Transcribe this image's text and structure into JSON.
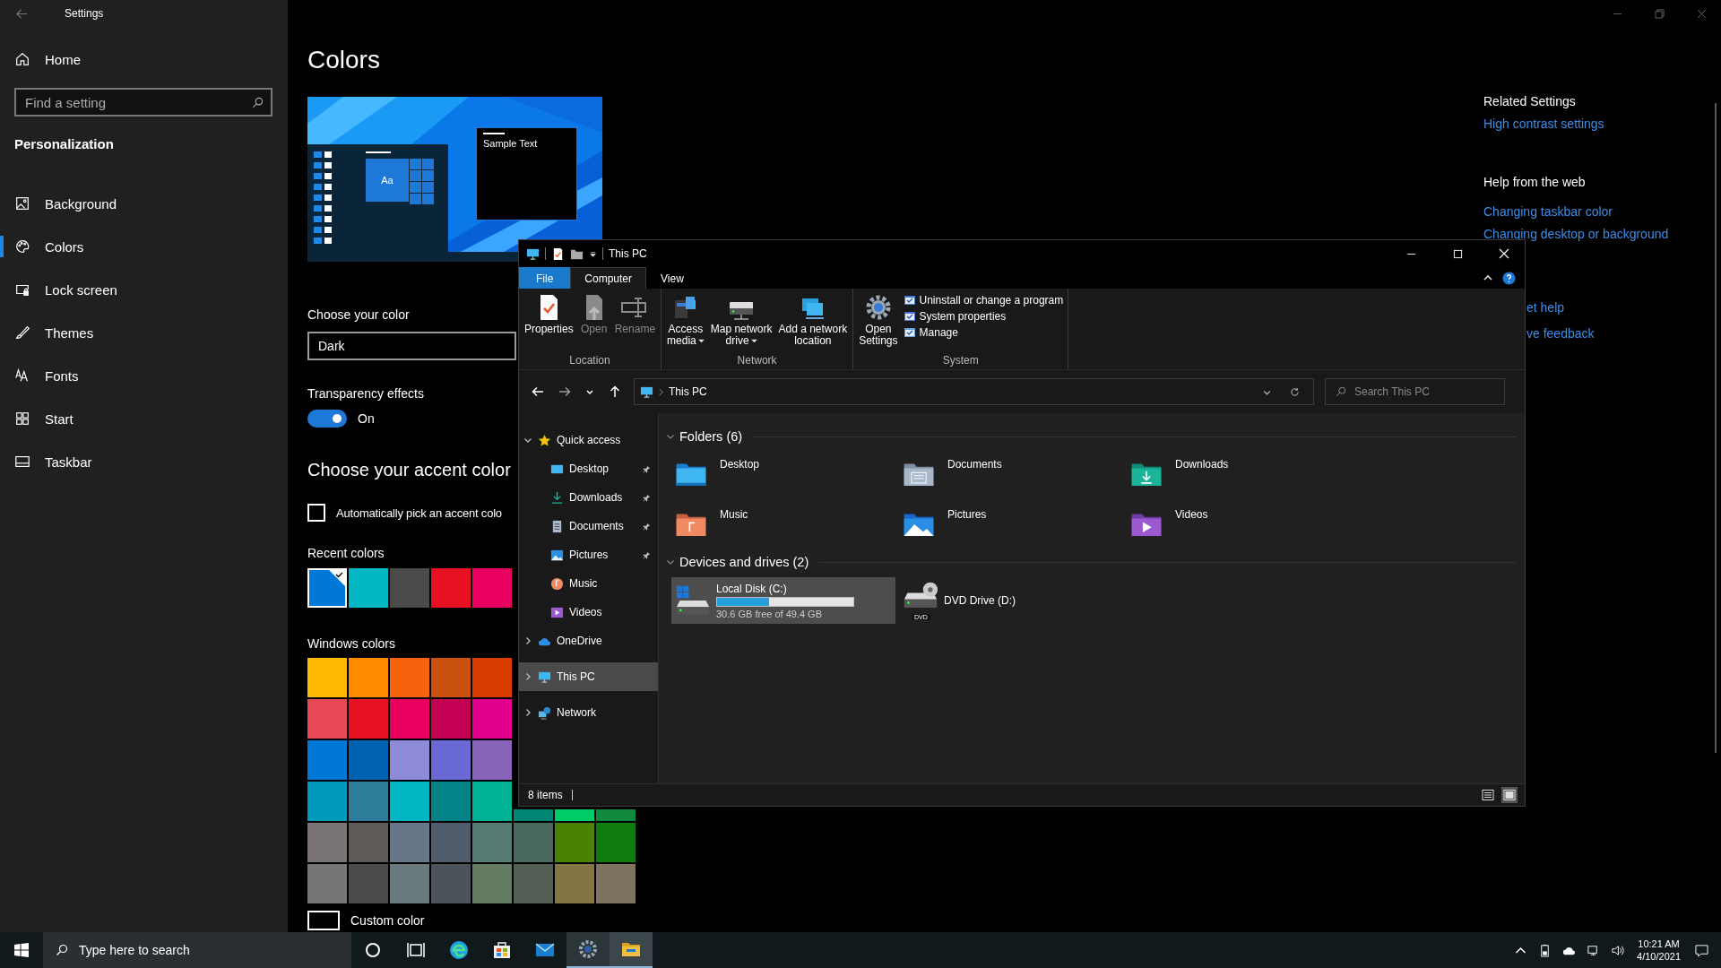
{
  "settings": {
    "title": "Settings",
    "home": "Home",
    "search": {
      "placeholder": "Find a setting"
    },
    "section": "Personalization",
    "nav": [
      {
        "label": "Background",
        "kind": "background",
        "selected": false
      },
      {
        "label": "Colors",
        "kind": "colors",
        "selected": true
      },
      {
        "label": "Lock screen",
        "kind": "lock",
        "selected": false
      },
      {
        "label": "Themes",
        "kind": "themes",
        "selected": false
      },
      {
        "label": "Fonts",
        "kind": "fonts",
        "selected": false
      },
      {
        "label": "Start",
        "kind": "start",
        "selected": false
      },
      {
        "label": "Taskbar",
        "kind": "taskbar",
        "selected": false
      }
    ],
    "page_title": "Colors",
    "preview": {
      "sample_text": "Sample Text",
      "tile_text": "Aa"
    },
    "color_mode": {
      "label": "Choose your color",
      "value": "Dark"
    },
    "transparency": {
      "label": "Transparency effects",
      "on": true,
      "state_text": "On"
    },
    "accent_title": "Choose your accent color",
    "auto_pick": {
      "label": "Automatically pick an accent colo",
      "checked": false
    },
    "recent": {
      "label": "Recent colors",
      "swatches": [
        {
          "color": "#0078d7",
          "selected": true
        },
        {
          "color": "#00b7c3",
          "selected": false
        },
        {
          "color": "#4c4a48",
          "selected": false
        },
        {
          "color": "#e81123",
          "selected": false
        },
        {
          "color": "#ea005e",
          "selected": false
        }
      ]
    },
    "windows_colors": {
      "label": "Windows colors",
      "rows": [
        [
          {
            "color": "#ffb900"
          },
          {
            "color": "#ff8c00"
          },
          {
            "color": "#f7630c"
          },
          {
            "color": "#ca5010"
          },
          {
            "color": "#da3b01"
          }
        ],
        [
          {
            "color": "#e74856"
          },
          {
            "color": "#e81123"
          },
          {
            "color": "#ea005e"
          },
          {
            "color": "#c30052"
          },
          {
            "color": "#e3008c"
          }
        ],
        [
          {
            "color": "#0078d7"
          },
          {
            "color": "#0063b1"
          },
          {
            "color": "#8e8cd8"
          },
          {
            "color": "#6b69d6"
          },
          {
            "color": "#8764b8"
          }
        ],
        [
          {
            "color": "#0099bc"
          },
          {
            "color": "#2d7d9a"
          },
          {
            "color": "#00b7c3"
          },
          {
            "color": "#038387"
          },
          {
            "color": "#00b294"
          },
          {
            "color": "#018574"
          },
          {
            "color": "#00cc6a"
          },
          {
            "color": "#10893e"
          }
        ],
        [
          {
            "color": "#7a7574"
          },
          {
            "color": "#5d5a58"
          },
          {
            "color": "#68768a"
          },
          {
            "color": "#515c6b"
          },
          {
            "color": "#567c73"
          },
          {
            "color": "#486860"
          },
          {
            "color": "#498205"
          },
          {
            "color": "#107c10"
          }
        ],
        [
          {
            "color": "#767676"
          },
          {
            "color": "#4c4a48"
          },
          {
            "color": "#69797e"
          },
          {
            "color": "#4a5459"
          },
          {
            "color": "#647c64"
          },
          {
            "color": "#525e54"
          },
          {
            "color": "#847545"
          },
          {
            "color": "#7e735f"
          }
        ]
      ]
    },
    "custom_color": "Custom color",
    "related": {
      "title": "Related Settings",
      "links": [
        "High contrast settings"
      ]
    },
    "help": {
      "title": "Help from the web",
      "links": [
        "Changing taskbar color",
        "Changing desktop or background"
      ]
    },
    "support_links": [
      "et help",
      "ve feedback"
    ]
  },
  "explorer": {
    "title": "This PC",
    "tabs": [
      {
        "label": "File",
        "kind": "file",
        "selected": false
      },
      {
        "label": "Computer",
        "kind": "tab",
        "selected": true
      },
      {
        "label": "View",
        "kind": "tab",
        "selected": false
      }
    ],
    "ribbon": [
      {
        "group": "Location",
        "commands": [
          {
            "label": "Properties",
            "disabled": false,
            "dropdown": false
          },
          {
            "label": "Open",
            "disabled": true,
            "dropdown": false
          },
          {
            "label": "Rename",
            "disabled": true,
            "dropdown": false
          }
        ]
      },
      {
        "group": "Network",
        "commands": [
          {
            "label": "Access\nmedia",
            "disabled": false,
            "dropdown": true
          },
          {
            "label": "Map network\ndrive",
            "disabled": false,
            "dropdown": true
          },
          {
            "label": "Add a network\nlocation",
            "disabled": false,
            "dropdown": false
          }
        ]
      },
      {
        "group": "System",
        "commands": [
          {
            "label": "Open\nSettings",
            "disabled": false,
            "dropdown": false
          }
        ],
        "small_commands": [
          {
            "label": "Uninstall or change a program"
          },
          {
            "label": "System properties"
          },
          {
            "label": "Manage"
          }
        ]
      }
    ],
    "address": {
      "path": "This PC"
    },
    "search": {
      "placeholder": "Search This PC"
    },
    "nav": [
      {
        "label": "Quick access",
        "kind": "star",
        "expanded": true,
        "selected": false,
        "children": [
          {
            "label": "Desktop",
            "kind": "desktop",
            "pinned": true
          },
          {
            "label": "Downloads",
            "kind": "downloads",
            "pinned": true
          },
          {
            "label": "Documents",
            "kind": "documents",
            "pinned": true
          },
          {
            "label": "Pictures",
            "kind": "pictures",
            "pinned": true
          },
          {
            "label": "Music",
            "kind": "music",
            "pinned": false
          },
          {
            "label": "Videos",
            "kind": "videos",
            "pinned": false
          }
        ]
      },
      {
        "label": "OneDrive",
        "kind": "cloud",
        "expanded": false,
        "selected": false
      },
      {
        "label": "This PC",
        "kind": "pc",
        "expanded": false,
        "selected": true
      },
      {
        "label": "Network",
        "kind": "network",
        "expanded": false,
        "selected": false
      }
    ],
    "groups": [
      {
        "title": "Folders (6)",
        "kind": "folders",
        "expanded": true,
        "items": [
          {
            "label": "Desktop",
            "kind": "desktop"
          },
          {
            "label": "Documents",
            "kind": "documents"
          },
          {
            "label": "Downloads",
            "kind": "downloads"
          },
          {
            "label": "Music",
            "kind": "music"
          },
          {
            "label": "Pictures",
            "kind": "pictures"
          },
          {
            "label": "Videos",
            "kind": "videos"
          }
        ]
      },
      {
        "title": "Devices and drives (2)",
        "kind": "drives",
        "expanded": true,
        "items": [
          {
            "label": "Local Disk (C:)",
            "kind": "disk",
            "detail": "30.6 GB free of 49.4 GB",
            "level": 0.38,
            "selected": true
          },
          {
            "label": "DVD Drive (D:)",
            "kind": "dvd",
            "icon_text": "DVD",
            "selected": false
          }
        ]
      }
    ],
    "status": "8 items",
    "views": [
      {
        "kind": "details",
        "selected": false
      },
      {
        "kind": "large",
        "selected": true
      }
    ]
  },
  "taskbar": {
    "search": {
      "placeholder": "Type here to search"
    },
    "apps": [
      {
        "kind": "cortana",
        "open": false,
        "active": false
      },
      {
        "kind": "taskview",
        "open": false,
        "active": false
      },
      {
        "kind": "edge",
        "open": false,
        "active": false
      },
      {
        "kind": "store",
        "open": false,
        "active": false
      },
      {
        "kind": "mail",
        "open": false,
        "active": false
      },
      {
        "kind": "settings",
        "open": true,
        "active": false
      },
      {
        "kind": "explorer",
        "open": true,
        "active": true
      }
    ],
    "time": "10:21 AM",
    "date": "4/10/2021"
  }
}
